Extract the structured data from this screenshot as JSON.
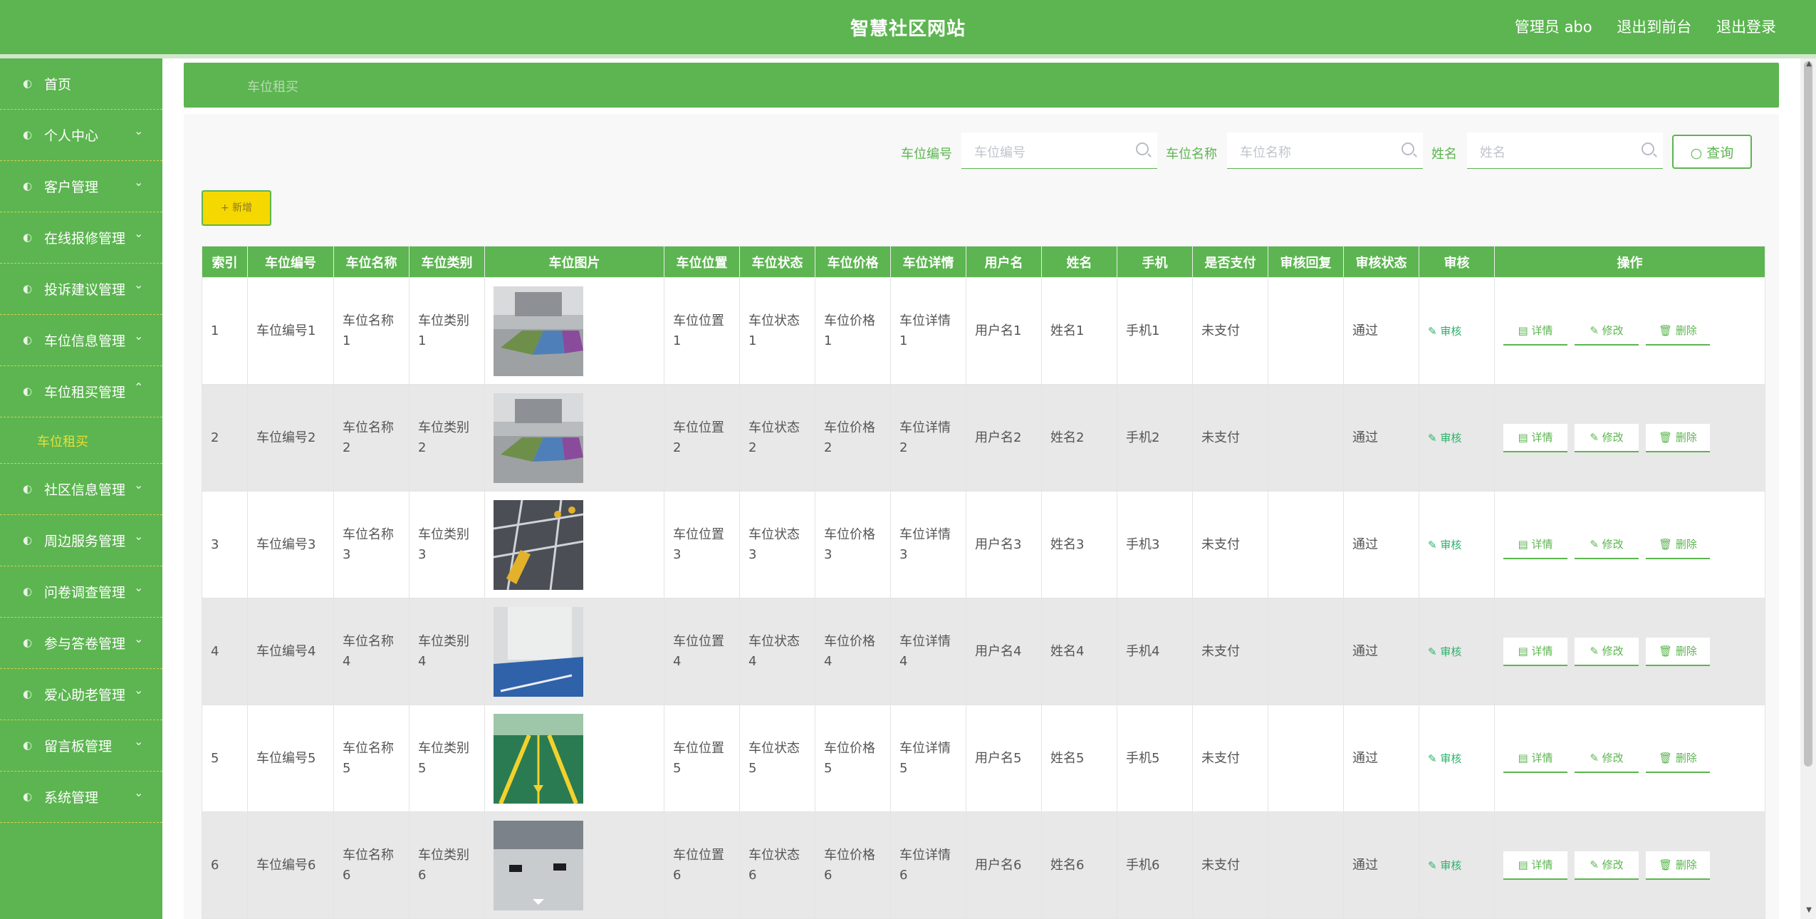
{
  "header": {
    "title": "智慧社区网站",
    "admin": "管理员 abo",
    "to_front": "退出到前台",
    "logout": "退出登录"
  },
  "sidebar": {
    "items": [
      {
        "label": "首页",
        "icon": "home-icon",
        "arrow": ""
      },
      {
        "label": "个人中心",
        "icon": "user-icon",
        "arrow": "⌄"
      },
      {
        "label": "客户管理",
        "icon": "customers-icon",
        "arrow": "⌄"
      },
      {
        "label": "在线报修管理",
        "icon": "repair-icon",
        "arrow": "⌄"
      },
      {
        "label": "投诉建议管理",
        "icon": "complaint-icon",
        "arrow": "⌄"
      },
      {
        "label": "车位信息管理",
        "icon": "parking-icon",
        "arrow": "⌄"
      },
      {
        "label": "车位租买管理",
        "icon": "parking-rent-icon",
        "arrow": "⌃"
      },
      {
        "label": "社区信息管理",
        "icon": "community-icon",
        "arrow": "⌄"
      },
      {
        "label": "周边服务管理",
        "icon": "service-icon",
        "arrow": "⌄"
      },
      {
        "label": "问卷调查管理",
        "icon": "survey-icon",
        "arrow": "⌄"
      },
      {
        "label": "参与答卷管理",
        "icon": "answer-icon",
        "arrow": "⌄"
      },
      {
        "label": "爱心助老管理",
        "icon": "care-icon",
        "arrow": "⌄"
      },
      {
        "label": "留言板管理",
        "icon": "message-icon",
        "arrow": "⌄"
      },
      {
        "label": "系统管理",
        "icon": "system-icon",
        "arrow": "⌄"
      }
    ],
    "sub_active": "车位租买"
  },
  "breadcrumb": "车位租买",
  "search": {
    "label1": "车位编号",
    "placeholder1": "车位编号",
    "label2": "车位名称",
    "placeholder2": "车位名称",
    "label3": "姓名",
    "placeholder3": "姓名",
    "query_label": "查询"
  },
  "add_label": "+ 新增",
  "table": {
    "headers": [
      "索引",
      "车位编号",
      "车位名称",
      "车位类别",
      "车位图片",
      "车位位置",
      "车位状态",
      "车位价格",
      "车位详情",
      "用户名",
      "姓名",
      "手机",
      "是否支付",
      "审核回复",
      "审核状态",
      "审核",
      "操作"
    ],
    "rows": [
      {
        "index": "1",
        "code": "车位编号1",
        "name": "车位名称 1",
        "category": "车位类别 1",
        "img": "indoor",
        "location": "车位位置 1",
        "status": "车位状态 1",
        "price": "车位价格 1",
        "detail": "车位详情 1",
        "username": "用户名1",
        "realname": "姓名1",
        "phone": "手机1",
        "paid": "未支付",
        "reply": "",
        "audit_status": "通过"
      },
      {
        "index": "2",
        "code": "车位编号2",
        "name": "车位名称 2",
        "category": "车位类别 2",
        "img": "indoor",
        "location": "车位位置 2",
        "status": "车位状态 2",
        "price": "车位价格 2",
        "detail": "车位详情 2",
        "username": "用户名2",
        "realname": "姓名2",
        "phone": "手机2",
        "paid": "未支付",
        "reply": "",
        "audit_status": "通过"
      },
      {
        "index": "3",
        "code": "车位编号3",
        "name": "车位名称 3",
        "category": "车位类别 3",
        "img": "lock",
        "location": "车位位置 3",
        "status": "车位状态 3",
        "price": "车位价格 3",
        "detail": "车位详情 3",
        "username": "用户名3",
        "realname": "姓名3",
        "phone": "手机3",
        "paid": "未支付",
        "reply": "",
        "audit_status": "通过"
      },
      {
        "index": "4",
        "code": "车位编号4",
        "name": "车位名称 4",
        "category": "车位类别 4",
        "img": "blue",
        "location": "车位位置 4",
        "status": "车位状态 4",
        "price": "车位价格 4",
        "detail": "车位详情 4",
        "username": "用户名4",
        "realname": "姓名4",
        "phone": "手机4",
        "paid": "未支付",
        "reply": "",
        "audit_status": "通过"
      },
      {
        "index": "5",
        "code": "车位编号5",
        "name": "车位名称 5",
        "category": "车位类别 5",
        "img": "green",
        "location": "车位位置 5",
        "status": "车位状态 5",
        "price": "车位价格 5",
        "detail": "车位详情 5",
        "username": "用户名5",
        "realname": "姓名5",
        "phone": "手机5",
        "paid": "未支付",
        "reply": "",
        "audit_status": "通过"
      },
      {
        "index": "6",
        "code": "车位编号6",
        "name": "车位名称 6",
        "category": "车位类别 6",
        "img": "grey",
        "location": "车位位置 6",
        "status": "车位状态 6",
        "price": "车位价格 6",
        "detail": "车位详情 6",
        "username": "用户名6",
        "realname": "姓名6",
        "phone": "手机6",
        "paid": "未支付",
        "reply": "",
        "audit_status": "通过"
      }
    ],
    "audit_link": "审核",
    "op_detail": "详情",
    "op_edit": "修改",
    "op_delete": "删除"
  },
  "colors": {
    "brand": "#5cb550",
    "accent": "#f5d800",
    "sub_active": "#e6df3b"
  }
}
